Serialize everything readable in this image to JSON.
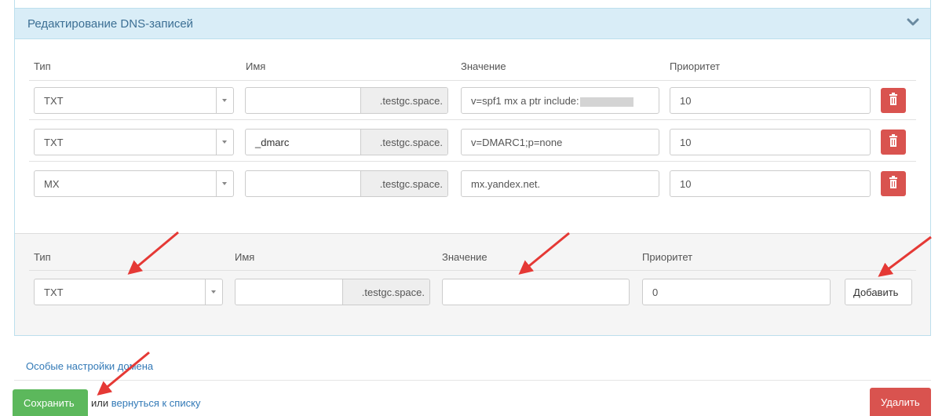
{
  "panel": {
    "title": "Редактирование DNS-записей"
  },
  "headers": {
    "type": "Тип",
    "name": "Имя",
    "value": "Значение",
    "priority": "Приоритет"
  },
  "domain_suffix": ".testgc.space.",
  "records": [
    {
      "type": "TXT",
      "name": "",
      "value": "v=spf1 mx a ptr include:",
      "priority": "10"
    },
    {
      "type": "TXT",
      "name": "_dmarc",
      "value": "v=DMARC1;p=none",
      "priority": "10"
    },
    {
      "type": "MX",
      "name": "",
      "value": "mx.yandex.net.",
      "priority": "10"
    }
  ],
  "new_record": {
    "type": "TXT",
    "name": "",
    "value": "",
    "priority": "0",
    "add_label": "Добавить"
  },
  "footer": {
    "special_settings_link": "Особые настройки домена",
    "save_label": "Сохранить",
    "or_text": "или",
    "back_link": "вернуться к списку",
    "delete_label": "Удалить"
  },
  "colors": {
    "danger": "#d9534f",
    "success": "#5cb85c",
    "info_bg": "#d9edf7",
    "link": "#337ab7",
    "annotation": "#e53935"
  }
}
